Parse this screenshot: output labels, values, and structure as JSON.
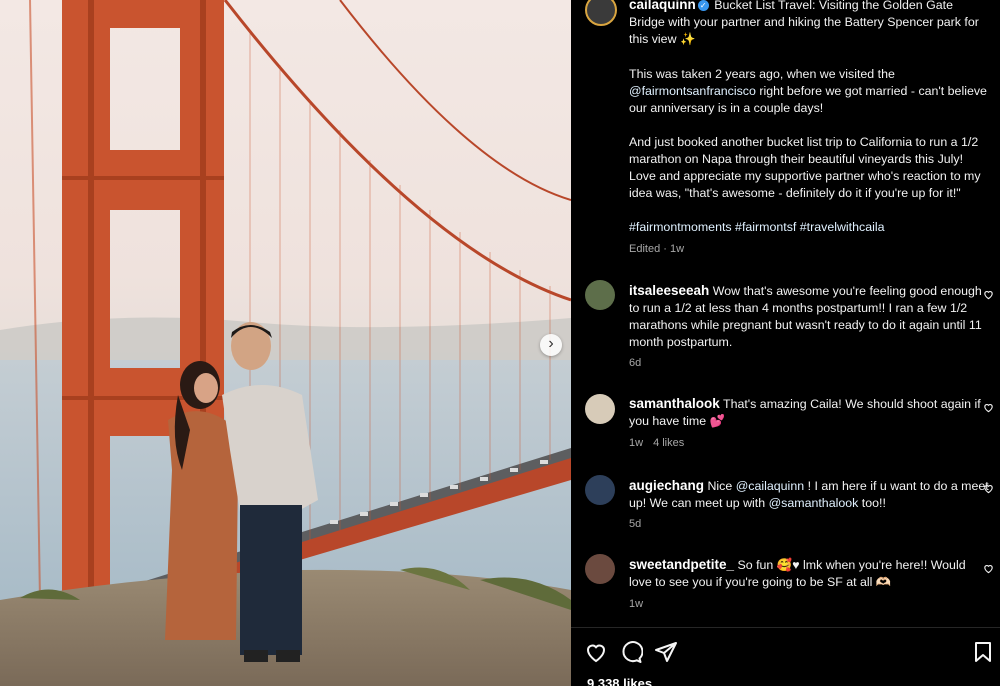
{
  "post": {
    "username": "cailaquinn",
    "caption_p1": "Bucket List Travel: Visiting the Golden Gate Bridge with your partner and hiking the Battery Spencer park for this view ✨",
    "caption_p2a": "This was taken 2 years ago, when we visited the",
    "caption_p2_mention": "@fairmontsanfrancisco",
    "caption_p2b": "right before we got married - can't believe our anniversary is in a couple days!",
    "caption_p3": "And just booked another bucket list trip to California to run a 1/2 marathon on Napa through their beautiful vineyards this July! Love and appreciate my supportive partner who's reaction to my idea was, \"that's awesome - definitely do it if you're up for it!\"",
    "hashtags": "#fairmontmoments #fairmontsf #travelwithcaila",
    "edited": "Edited · 1w",
    "likes": "9,338 likes"
  },
  "comments": [
    {
      "username": "itsaleeseeah",
      "text": "Wow that's awesome you're feeling good enough to run a 1/2 at less than 4 months postpartum!! I ran a few 1/2 marathons while pregnant but wasn't ready to do it again until 11 month postpartum.",
      "time": "6d"
    },
    {
      "username": "samanthalook",
      "text": "That's amazing Caila! We should shoot again if you have time 💕",
      "time": "1w",
      "likes": "4 likes"
    },
    {
      "username": "augiechang",
      "text_a": "Nice",
      "mention1": "@cailaquinn",
      "text_b": "! I am here if u want to do a meet up! We can meet up with",
      "mention2": "@samanthalook",
      "text_c": "too!!",
      "time": "5d"
    },
    {
      "username": "sweetandpetite_",
      "text": "So fun 🥰♥ lmk when you're here!! Would love to see you if you're going to be SF at all 🫶🏻",
      "time": "1w"
    }
  ],
  "icons": {
    "like": "heart-icon",
    "comment": "comment-icon",
    "share": "share-icon",
    "save": "bookmark-icon",
    "next": "chevron-right-icon"
  },
  "colors": {
    "background": "#000000",
    "bridge": "#c9542f",
    "verified": "#3897f0",
    "owner_ring": "#d9a540"
  }
}
